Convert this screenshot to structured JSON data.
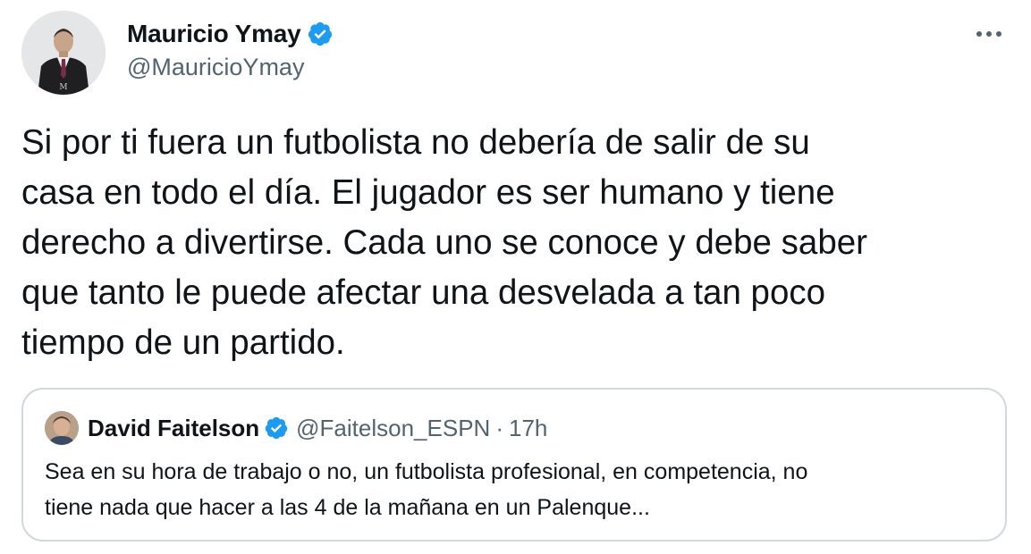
{
  "author": {
    "name": "Mauricio Ymay",
    "handle": "@MauricioYmay",
    "verified_color": "#1d9bf0"
  },
  "tweet": {
    "text": "Si por ti fuera un futbolista no debería de salir de su\ncasa en todo el día. El jugador es ser humano y tiene\nderecho a divertirse. Cada uno se conoce y debe saber\nque tanto le puede afectar una desvelada a tan poco\ntiempo de un partido."
  },
  "quote": {
    "name": "David Faitelson",
    "handle": "@Faitelson_ESPN",
    "separator": "·",
    "time": "17h",
    "text": "Sea en su hora de trabajo o no, un futbolista profesional, en competencia, no\ntiene nada que hacer a las 4 de la mañana en un Palenque..."
  },
  "icons": {
    "more": "more-options-icon",
    "verified": "verified-badge-icon"
  },
  "colors": {
    "text": "#0f1419",
    "secondary": "#536471",
    "border": "#cfd9de",
    "verified": "#1d9bf0"
  }
}
